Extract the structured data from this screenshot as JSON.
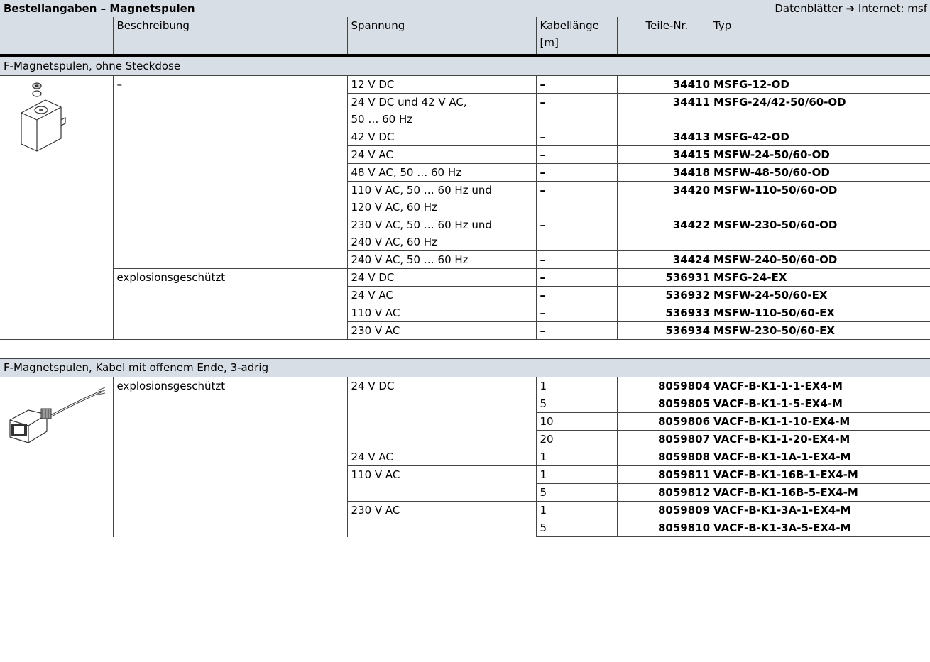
{
  "header": {
    "title": "Bestellangaben – Magnetspulen",
    "right_prefix": "Datenblätter",
    "right_arrow": "➔",
    "right_suffix": "Internet: msf"
  },
  "columns": {
    "beschreibung": "Beschreibung",
    "spannung": "Spannung",
    "kabellaenge_1": "Kabellänge",
    "kabellaenge_2": "[m]",
    "teile_nr": "Teile-Nr.",
    "typ": "Typ"
  },
  "section1": {
    "title": "F-Magnetspulen, ohne Steckdose",
    "image_icon": "solenoid-coil-icon",
    "groups": [
      {
        "beschreibung": "–",
        "rows": [
          {
            "spannung": [
              "12 V DC"
            ],
            "kabellaenge": "–",
            "teile_nr": "34410",
            "typ": "MSFG-12-OD"
          },
          {
            "spannung": [
              "24 V DC und 42 V AC,",
              "50 … 60 Hz"
            ],
            "kabellaenge": "–",
            "teile_nr": "34411",
            "typ": "MSFG-24/42-50/60-OD"
          },
          {
            "spannung": [
              "42 V DC"
            ],
            "kabellaenge": "–",
            "teile_nr": "34413",
            "typ": "MSFG-42-OD"
          },
          {
            "spannung": [
              "24 V AC"
            ],
            "kabellaenge": "–",
            "teile_nr": "34415",
            "typ": "MSFW-24-50/60-OD"
          },
          {
            "spannung": [
              "48 V AC, 50 … 60 Hz"
            ],
            "kabellaenge": "–",
            "teile_nr": "34418",
            "typ": "MSFW-48-50/60-OD"
          },
          {
            "spannung": [
              "110 V AC, 50 … 60 Hz und",
              "120 V AC, 60 Hz"
            ],
            "kabellaenge": "–",
            "teile_nr": "34420",
            "typ": "MSFW-110-50/60-OD"
          },
          {
            "spannung": [
              "230 V AC, 50 … 60 Hz und",
              "240 V AC, 60 Hz"
            ],
            "kabellaenge": "–",
            "teile_nr": "34422",
            "typ": "MSFW-230-50/60-OD"
          },
          {
            "spannung": [
              "240 V AC, 50 … 60 Hz"
            ],
            "kabellaenge": "–",
            "teile_nr": "34424",
            "typ": "MSFW-240-50/60-OD"
          }
        ]
      },
      {
        "beschreibung": "explosionsgeschützt",
        "rows": [
          {
            "spannung": [
              "24 V DC"
            ],
            "kabellaenge": "–",
            "teile_nr": "536931",
            "typ": "MSFG-24-EX"
          },
          {
            "spannung": [
              "24 V AC"
            ],
            "kabellaenge": "–",
            "teile_nr": "536932",
            "typ": "MSFW-24-50/60-EX"
          },
          {
            "spannung": [
              "110 V AC"
            ],
            "kabellaenge": "–",
            "teile_nr": "536933",
            "typ": "MSFW-110-50/60-EX"
          },
          {
            "spannung": [
              "230 V AC"
            ],
            "kabellaenge": "–",
            "teile_nr": "536934",
            "typ": "MSFW-230-50/60-EX"
          }
        ]
      }
    ]
  },
  "section2": {
    "title": "F-Magnetspulen, Kabel mit offenem Ende, 3-adrig",
    "image_icon": "cable-coil-icon",
    "beschreibung": "explosionsgeschützt",
    "voltage_groups": [
      {
        "spannung": "24 V DC",
        "rows": [
          {
            "kabellaenge": "1",
            "teile_nr": "8059804",
            "typ": "VACF-B-K1-1-1-EX4-M"
          },
          {
            "kabellaenge": "5",
            "teile_nr": "8059805",
            "typ": "VACF-B-K1-1-5-EX4-M"
          },
          {
            "kabellaenge": "10",
            "teile_nr": "8059806",
            "typ": "VACF-B-K1-1-10-EX4-M"
          },
          {
            "kabellaenge": "20",
            "teile_nr": "8059807",
            "typ": "VACF-B-K1-1-20-EX4-M"
          }
        ]
      },
      {
        "spannung": "24 V AC",
        "rows": [
          {
            "kabellaenge": "1",
            "teile_nr": "8059808",
            "typ": "VACF-B-K1-1A-1-EX4-M"
          }
        ]
      },
      {
        "spannung": "110 V AC",
        "rows": [
          {
            "kabellaenge": "1",
            "teile_nr": "8059811",
            "typ": "VACF-B-K1-16B-1-EX4-M"
          },
          {
            "kabellaenge": "5",
            "teile_nr": "8059812",
            "typ": "VACF-B-K1-16B-5-EX4-M"
          }
        ]
      },
      {
        "spannung": "230 V AC",
        "rows": [
          {
            "kabellaenge": "1",
            "teile_nr": "8059809",
            "typ": "VACF-B-K1-3A-1-EX4-M"
          },
          {
            "kabellaenge": "5",
            "teile_nr": "8059810",
            "typ": "VACF-B-K1-3A-5-EX4-M"
          }
        ]
      }
    ]
  }
}
